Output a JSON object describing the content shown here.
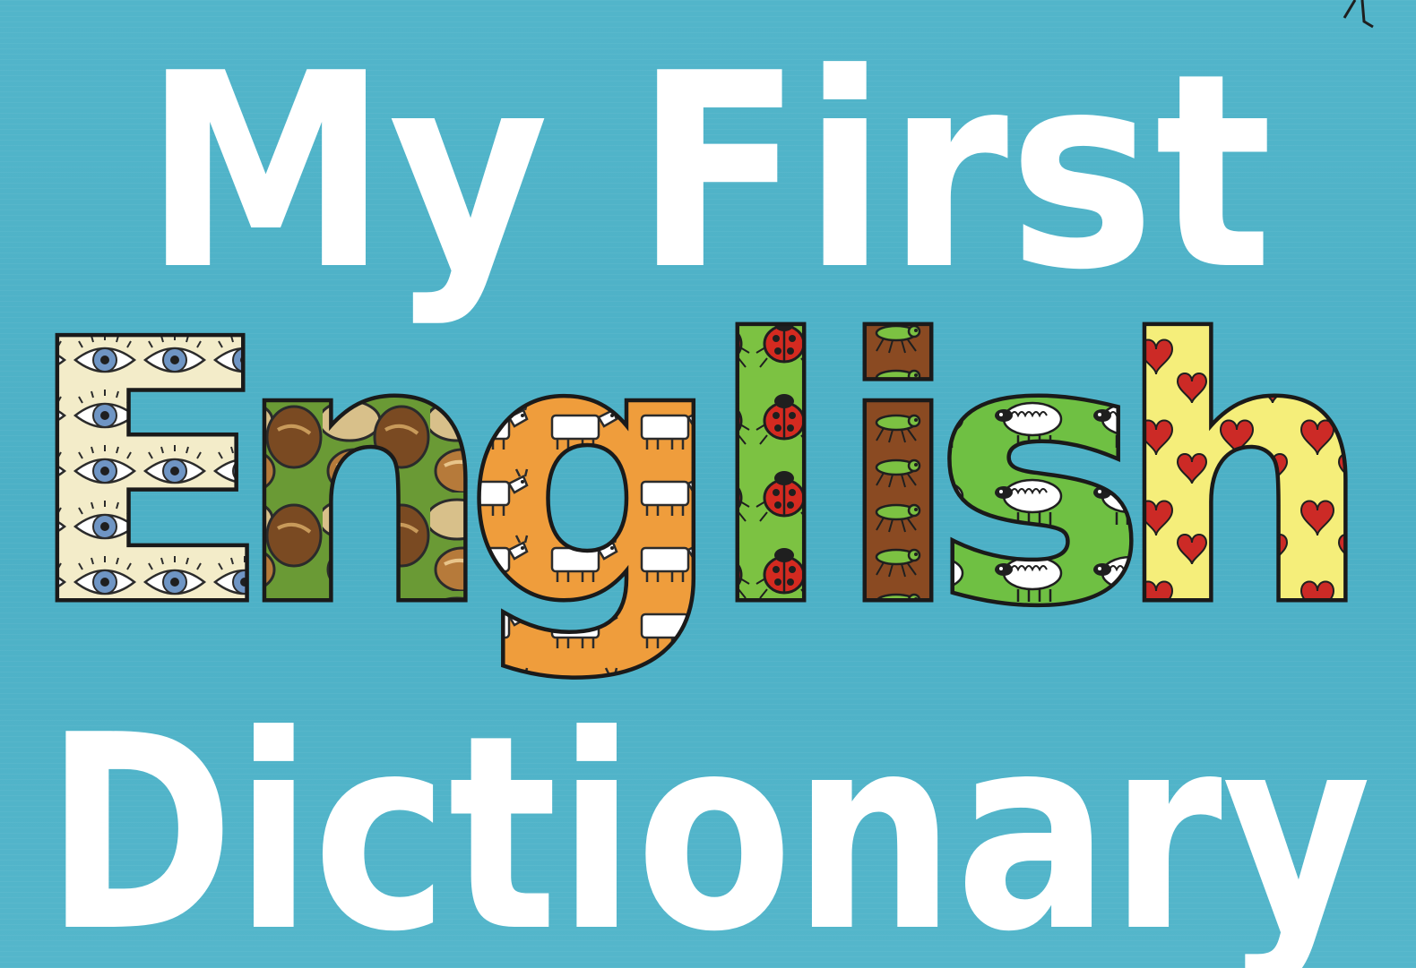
{
  "cover": {
    "title_line1": "My First",
    "title_line2_letters": [
      {
        "char": "E",
        "pattern": "eyes-pattern",
        "color": "#f3ecc9"
      },
      {
        "char": "n",
        "pattern": "nuts-pattern",
        "color": "#c9a56b"
      },
      {
        "char": "g",
        "pattern": "goats-pattern",
        "color": "#ef9d3c"
      },
      {
        "char": "l",
        "pattern": "ladybirds-pattern",
        "color": "#7cc242"
      },
      {
        "char": "i",
        "pattern": "insects-pattern",
        "color": "#8a4a22"
      },
      {
        "char": "s",
        "pattern": "sheep-pattern",
        "color": "#6fc043"
      },
      {
        "char": "h",
        "pattern": "hearts-pattern",
        "color": "#f5ee7a"
      }
    ],
    "title_line3": "Dictionary",
    "background_color": "#4fb2c8",
    "text_color": "#ffffff"
  }
}
